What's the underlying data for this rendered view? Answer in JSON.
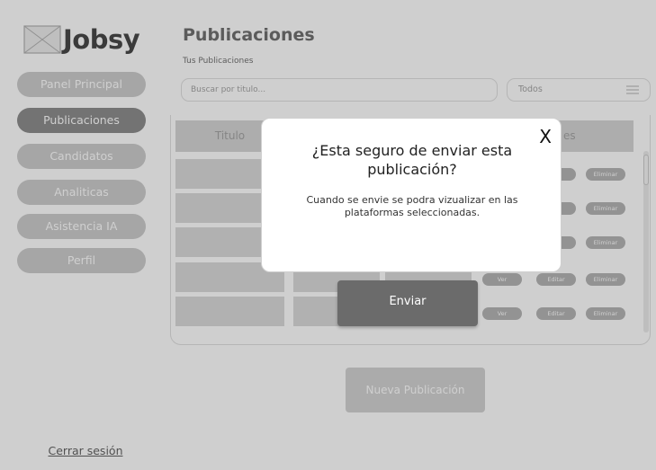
{
  "app": {
    "name": "Jobsy"
  },
  "sidebar": {
    "items": [
      {
        "label": "Panel Principal"
      },
      {
        "label": "Publicaciones"
      },
      {
        "label": "Candidatos"
      },
      {
        "label": "Analiticas"
      },
      {
        "label": "Asistencia IA"
      },
      {
        "label": "Perfil"
      }
    ],
    "active_item": "Publicaciones",
    "logout_label": "Cerrar sesión"
  },
  "main": {
    "title": "Publicaciones",
    "subtitle": "Tus Publicaciones",
    "search_placeholder": "Buscar por titulo...",
    "filter_value": "Todos",
    "table": {
      "headers": [
        "Titulo",
        "",
        "",
        "es"
      ],
      "row_actions": [
        "Ver",
        "Editar",
        "Eliminar"
      ],
      "visible_action_partials": [
        "ar",
        "Eliminar"
      ]
    },
    "new_button": "Nueva Publicación"
  },
  "modal": {
    "close_label": "X",
    "title": "¿Esta seguro de enviar esta publicación?",
    "body": "Cuando se envie se podra vizualizar en las plataformas seleccionadas.",
    "confirm_label": "Enviar"
  },
  "colors": {
    "active_nav": "#6b6b6b",
    "nav": "#bdbdbd",
    "pill": "#9e9e9e",
    "confirm": "#6b6b6b"
  }
}
